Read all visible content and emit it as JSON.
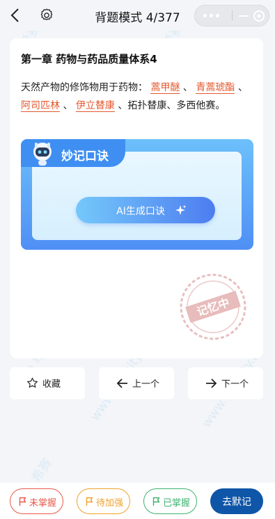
{
  "header": {
    "title": "背题模式 4/377"
  },
  "question": {
    "chapter": "第一章 药物与药品质量体系4",
    "prefix": "天然产物的修饰物用于药物：",
    "answers": [
      "蒿甲醚",
      "青蒿琥酯",
      "阿司匹林",
      "伊立替康"
    ],
    "separator": "、",
    "suffix": "拓扑替康、多西他赛。"
  },
  "mnemonic": {
    "title": "妙记口诀",
    "ai_button": "AI生成口诀"
  },
  "actions": {
    "favorite": "收藏",
    "prev": "上一个",
    "next": "下一个"
  },
  "bottom": {
    "not_mastered": "未掌握",
    "to_strengthen": "待加强",
    "mastered": "已掌握",
    "go_recite": "去默记"
  },
  "watermark": {
    "stamp": "记忆中"
  },
  "colors": {
    "answer": "#e4572e",
    "not_mastered": "#e8584a",
    "to_strengthen": "#f0a12c",
    "mastered": "#3cb36f",
    "primary": "#0f56a8",
    "mnemo_blue": "#3f8ff2"
  }
}
